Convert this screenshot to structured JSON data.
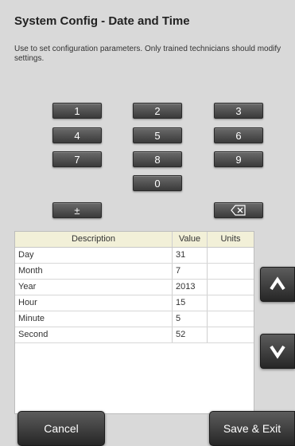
{
  "header": {
    "title": "System Config - Date and Time",
    "subtitle": "Use to set configuration parameters. Only trained technicians should modify settings."
  },
  "keypad": {
    "keys": [
      "1",
      "2",
      "3",
      "4",
      "5",
      "6",
      "7",
      "8",
      "9",
      "0",
      "±"
    ],
    "backspace_icon": "backspace-icon"
  },
  "table": {
    "headers": {
      "description": "Description",
      "value": "Value",
      "units": "Units"
    },
    "rows": [
      {
        "description": "Day",
        "value": "31",
        "units": ""
      },
      {
        "description": "Month",
        "value": "7",
        "units": ""
      },
      {
        "description": "Year",
        "value": "2013",
        "units": ""
      },
      {
        "description": "Hour",
        "value": "15",
        "units": ""
      },
      {
        "description": "Minute",
        "value": "5",
        "units": ""
      },
      {
        "description": "Second",
        "value": "52",
        "units": ""
      }
    ]
  },
  "scroll": {
    "up_icon": "chevron-up-icon",
    "down_icon": "chevron-down-icon"
  },
  "footer": {
    "cancel_label": "Cancel",
    "save_label": "Save & Exit"
  },
  "colors": {
    "background": "#d9d9d9",
    "button": "#3a3a3a",
    "table_header": "#f2f0d8"
  }
}
